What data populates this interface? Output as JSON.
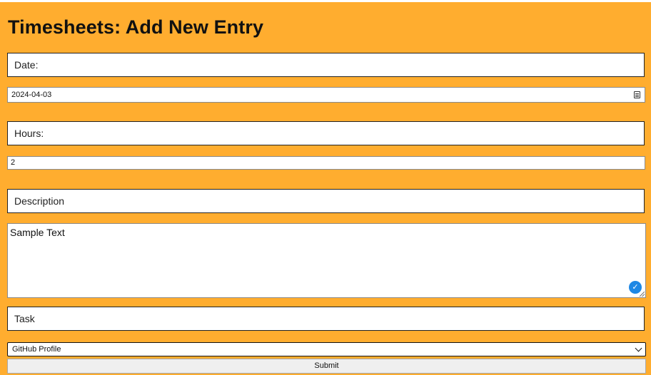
{
  "page": {
    "title": "Timesheets: Add New Entry"
  },
  "form": {
    "date": {
      "label": "Date:",
      "value": "2024-04-03"
    },
    "hours": {
      "label": "Hours:",
      "value": "2"
    },
    "description": {
      "label": "Description",
      "value": "Sample Text"
    },
    "task": {
      "label": "Task",
      "selected": "GitHub Profile"
    },
    "submit_label": "Submit"
  },
  "icons": {
    "date_picker": "calendar-icon",
    "grammar_check": "check-icon",
    "select_arrow": "chevron-down-icon"
  },
  "colors": {
    "background": "#ffad2f",
    "grammar_badge": "#1e88e5"
  }
}
